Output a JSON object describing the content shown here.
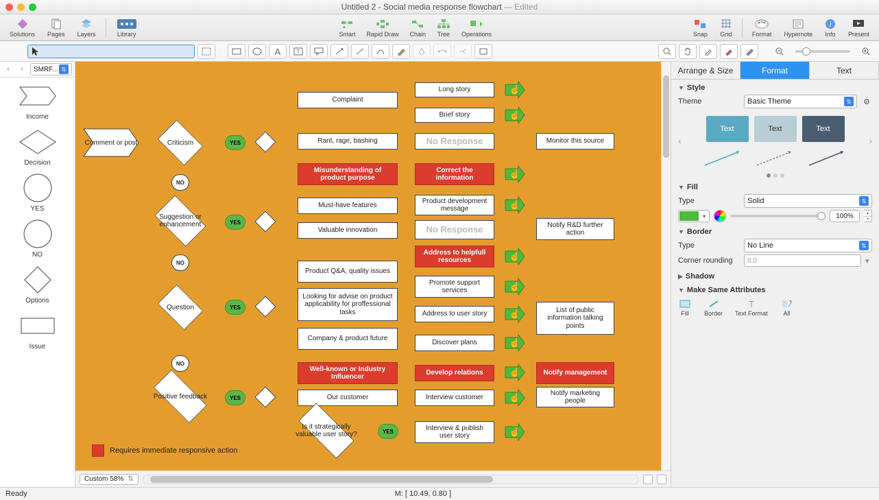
{
  "window": {
    "title": "Untitled 2 - Social media response flowchart",
    "edited": " — Edited"
  },
  "toolbar": {
    "solutions": "Solutions",
    "pages": "Pages",
    "layers": "Layers",
    "library": "Library",
    "smart": "Smart",
    "rapid": "Rapid Draw",
    "chain": "Chain",
    "tree": "Tree",
    "operations": "Operations",
    "snap": "Snap",
    "grid": "Grid",
    "format": "Format",
    "hypernote": "Hypernote",
    "info": "Info",
    "present": "Present"
  },
  "libselect": "SMRF...",
  "shapes": {
    "income": "Income",
    "decision": "Decision",
    "yes": "YES",
    "no": "NO",
    "options": "Options",
    "issue": "Issue"
  },
  "zoomsel": "Custom 58%",
  "flow": {
    "start": "Comment or post",
    "criticism": "Criticism",
    "yes": "YES",
    "no": "NO",
    "complaint": "Complaint",
    "longstory": "Long story",
    "briefstory": "Brief story",
    "rant": "Rant, rage, bashing",
    "noresp": "No Response",
    "monitor": "Monitor this source",
    "misunder": "Misunderstanding of product purpose",
    "correct": "Correct the information",
    "suggest": "Suggestion or enhancement",
    "must": "Must-have features",
    "devmsg": "Product development message",
    "valuable": "Valuable innovation",
    "noresp2": "No Response",
    "notifyrd": "Notify R&D further action",
    "question": "Question",
    "qa": "Product Q&A, quality issues",
    "address": "Address to helpfull resources",
    "advise": "Looking for advise on product applicability for proffessional tasks",
    "promote": "Promote support services",
    "userstory": "Address to user story",
    "talking": "List of public information talking points",
    "future": "Company & product future",
    "discover": "Discover plans",
    "influencer": "Well-known or Industry Influencer",
    "develop": "Develop relations",
    "notifymgmt": "Notify management",
    "positive": "Positive feedback",
    "ourcust": "Our customer",
    "interview": "Interview customer",
    "notifymkt": "Notify marketing people",
    "strategic": "Is it strategically valuable user story?",
    "publish": "Interview & publish user story",
    "legend": "Requires immediate responsive action"
  },
  "panel": {
    "tabs": {
      "arrange": "Arrange & Size",
      "format": "Format",
      "text": "Text"
    },
    "style": "Style",
    "theme": "Theme",
    "themeval": "Basic Theme",
    "text": "Text",
    "fill": "Fill",
    "filltype": "Type",
    "filltypeval": "Solid",
    "opacity": "100%",
    "border": "Border",
    "bordertype": "Type",
    "bordertypeval": "No Line",
    "corner": "Corner rounding",
    "cornerval": "0.0",
    "shadow": "Shadow",
    "same": "Make Same Attributes",
    "samebtns": {
      "fill": "Fill",
      "border": "Border",
      "textfmt": "Text Format",
      "all": "All"
    }
  },
  "status": {
    "ready": "Ready",
    "mouse": "M: [ 10.49, 0.80 ]"
  }
}
